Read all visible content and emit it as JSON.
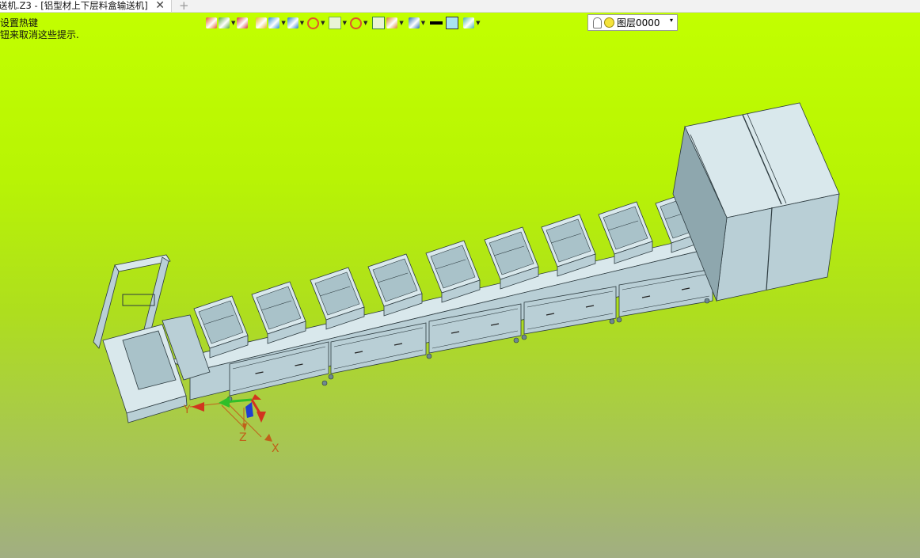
{
  "tab": {
    "title": "送机.Z3 - [铝型材上下层料盒输送机]",
    "close": "✕",
    "new_tab": "+"
  },
  "hints": [
    "设置热键",
    "钮来取消这些提示."
  ],
  "toolbar": {
    "buttons": [
      {
        "name": "import-icon",
        "color": "#e35d2b",
        "dropdown": false
      },
      {
        "name": "layers-icon",
        "color": "#59a93d",
        "dropdown": true
      },
      {
        "name": "pen-icon",
        "color": "#d43a3a",
        "dropdown": false
      },
      {
        "name": "shaded-cube-icon",
        "color": "#e7b52a",
        "dropdown": false
      },
      {
        "name": "solid-cube-icon",
        "color": "#2f8fd6",
        "dropdown": true
      },
      {
        "name": "view-cube-icon",
        "color": "#2a7cc6",
        "dropdown": true
      },
      {
        "name": "render-sphere-icon",
        "color": "#e2542c",
        "dropdown": true
      },
      {
        "name": "section-view-icon",
        "color": "#7cb342",
        "dropdown": true
      },
      {
        "name": "target-icon",
        "color": "#e0542a",
        "dropdown": true
      },
      {
        "name": "zoom-window-icon",
        "color": "#3b8a3b",
        "dropdown": false
      },
      {
        "name": "dimension-icon",
        "color": "#d9822b",
        "dropdown": true
      },
      {
        "name": "display-settings-icon",
        "color": "#2e6fb5",
        "dropdown": true
      },
      {
        "name": "line-weight-icon",
        "color": "#000000",
        "dropdown": false
      },
      {
        "name": "fill-color-icon",
        "color": "#a9e3f2",
        "dropdown": false
      },
      {
        "name": "layer-stack-icon",
        "color": "#49b5a5",
        "dropdown": true
      }
    ],
    "layer": {
      "name": "图层0000",
      "dropdown": "▾"
    }
  },
  "triad": {
    "x_label": "X",
    "y_label": "Y",
    "z_label": "Z"
  },
  "colors": {
    "part": "#b9cfd6",
    "part_light": "#d9e8ec",
    "part_dark": "#6f8890",
    "edge": "#2c3a3f",
    "axis_x": "#d1351f",
    "axis_y": "#2fbf29",
    "axis_z": "#1f3fd1",
    "triad_label": "#c0601a"
  }
}
